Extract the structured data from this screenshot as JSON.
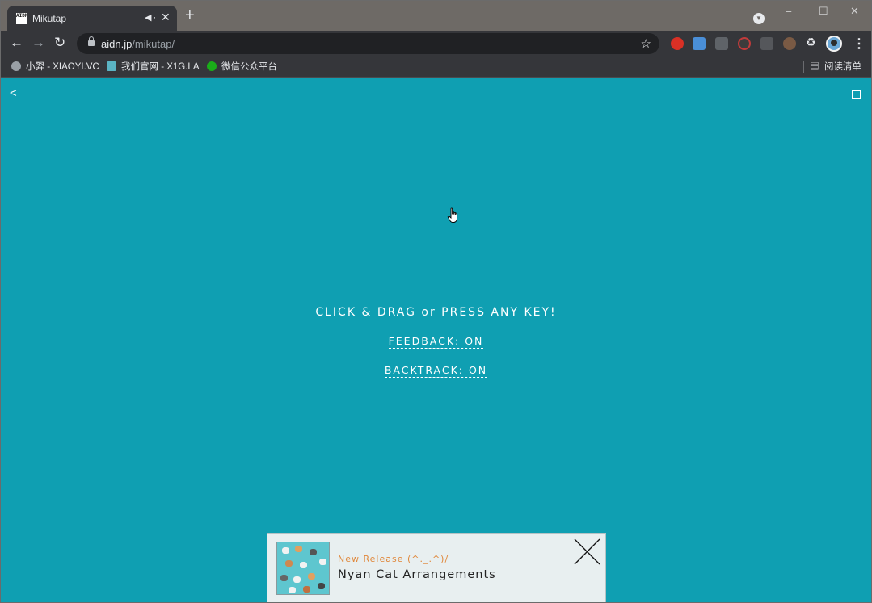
{
  "browser": {
    "tab": {
      "title": "Mikutap",
      "favicon_text": "AIDN",
      "mute_icon": "speaker-muted-icon",
      "close_icon": "close-icon"
    },
    "new_tab": "+",
    "window_controls": [
      "–",
      "☐",
      "✕"
    ],
    "address_bar": {
      "host": "aidn.jp",
      "path": "/mikutap/"
    },
    "bookmarks": [
      {
        "label": "小羿 - XIAOYI.VC",
        "color": "#9aa0a6"
      },
      {
        "label": "我们官网 - X1G.LA",
        "color": "#5bb4c4"
      },
      {
        "label": "微信公众平台",
        "color": "#1aad19"
      }
    ],
    "reading_list": "阅读清单"
  },
  "page": {
    "back_label": "<",
    "instructions": "CLICK & DRAG or PRESS ANY KEY!",
    "feedback_toggle": "FEEDBACK: ON",
    "backtrack_toggle": "BACKTRACK: ON",
    "background_color": "#0f9fb2"
  },
  "banner": {
    "release_label": "New Release (^._.^)/",
    "release_title": "Nyan Cat Arrangements",
    "label_color": "#e0873a"
  }
}
